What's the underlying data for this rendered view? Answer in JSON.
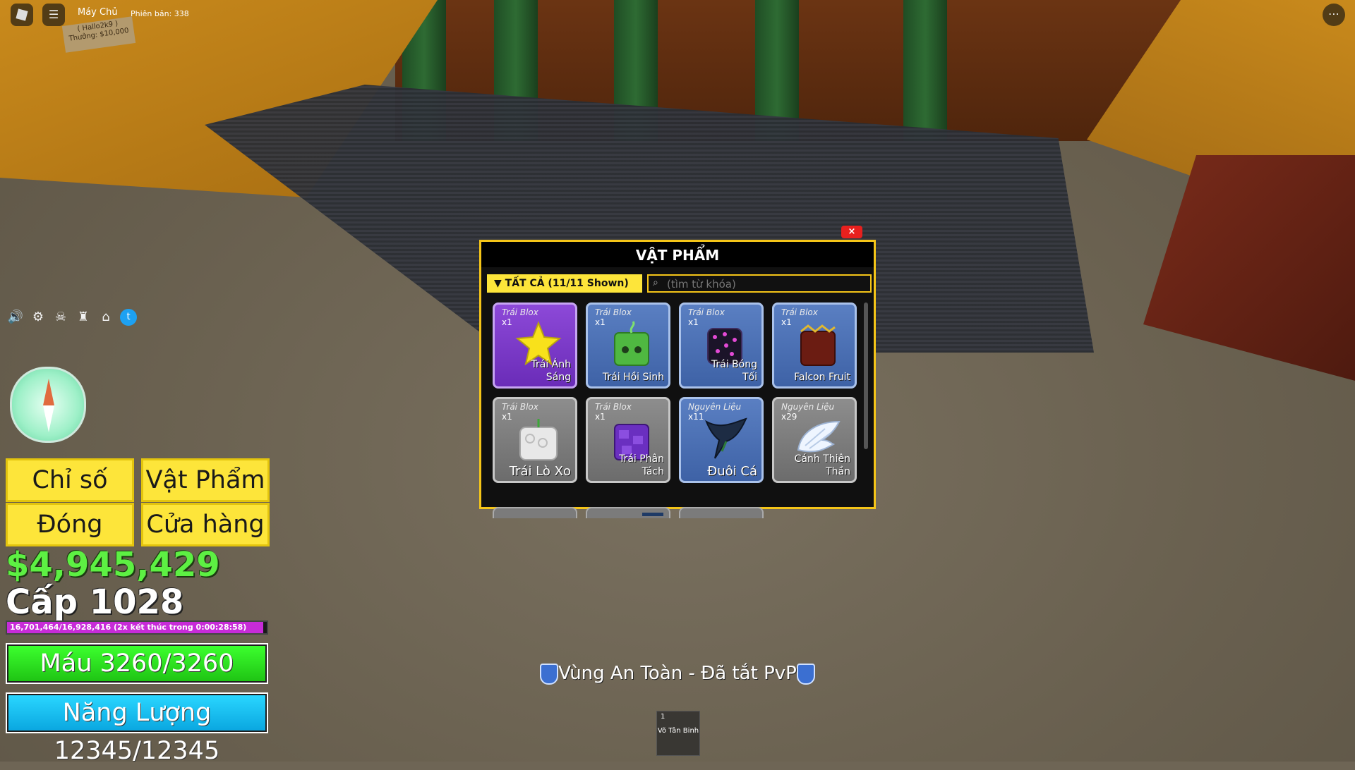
{
  "topbar": {
    "server_label": "Máy Chủ",
    "version": "Phiên bản: 338",
    "sign_text": "( Hallo2k9 )\nThưởng: $10,000"
  },
  "left_menu": {
    "stats_label": "Chỉ số",
    "items_label": "Vật Phẩm",
    "close_label": "Đóng",
    "shop_label": "Cửa hàng"
  },
  "player": {
    "money": "$4,945,429",
    "level": "Cấp 1028",
    "xp_text": "16,701,464/16,928,416 (2x kết thúc trong 0:00:28:58)",
    "xp_fraction": 0.987,
    "health": "Máu 3260/3260",
    "energy": "Năng Lượng 12345/12345"
  },
  "inventory": {
    "title": "VẬT PHẨM",
    "close_symbol": "×",
    "filter_label": "TẤT CẢ (11/11 Shown)",
    "search_placeholder": "(tìm từ khóa)",
    "items": [
      {
        "category": "Trái Blox",
        "qty": "x1",
        "name": "Trái Ánh Sáng",
        "rarity": "purple"
      },
      {
        "category": "Trái Blox",
        "qty": "x1",
        "name": "Trái Hồi Sinh",
        "rarity": "blue"
      },
      {
        "category": "Trái Blox",
        "qty": "x1",
        "name": "Trái Bóng Tối",
        "rarity": "blue"
      },
      {
        "category": "Trái Blox",
        "qty": "x1",
        "name": "Falcon Fruit",
        "rarity": "blue"
      },
      {
        "category": "Trái Blox",
        "qty": "x1",
        "name": "Trái Lò Xo",
        "rarity": "gray"
      },
      {
        "category": "Trái Blox",
        "qty": "x1",
        "name": "Trái Phân Tách",
        "rarity": "gray"
      },
      {
        "category": "Nguyên Liệu",
        "qty": "x11",
        "name": "Đuôi Cá",
        "rarity": "blue"
      },
      {
        "category": "Nguyên Liệu",
        "qty": "x29",
        "name": "Cánh Thiên Thần",
        "rarity": "gray"
      }
    ]
  },
  "safe_zone": "Vùng An Toàn - Đã tắt PvP",
  "hotbar": {
    "slot": "1",
    "label": "Võ Tân Binh"
  },
  "colors": {
    "accent": "#fde53a",
    "money": "#5df043",
    "health": "#3cff2e",
    "energy": "#2ad6ff",
    "xp": "#c72bd8"
  }
}
